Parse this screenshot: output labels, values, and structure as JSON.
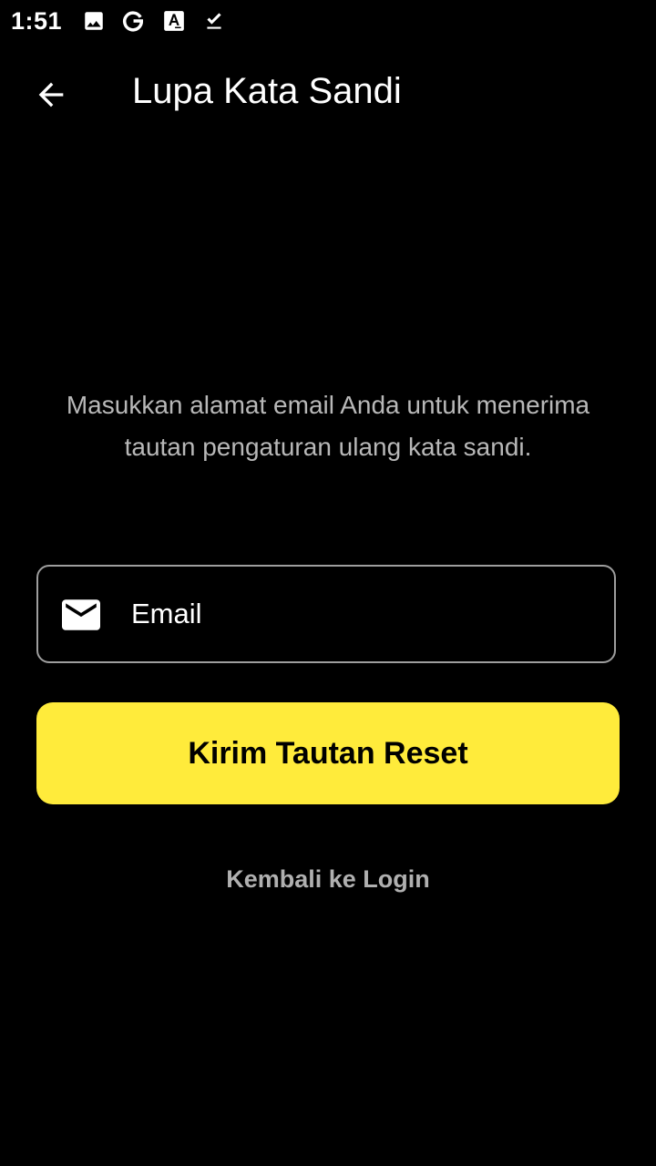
{
  "status_bar": {
    "time": "1:51",
    "icons": [
      "image-icon",
      "google-icon",
      "translate-a-icon",
      "download-done-icon"
    ]
  },
  "app_bar": {
    "title": "Lupa Kata Sandi",
    "back_icon": "arrow-left-icon"
  },
  "form": {
    "description": "Masukkan alamat email Anda untuk menerima tautan pengaturan ulang kata sandi.",
    "email_placeholder": "Email",
    "email_value": "",
    "email_icon": "mail-icon",
    "submit_label": "Kirim Tautan Reset",
    "back_to_login_label": "Kembali ke Login"
  },
  "colors": {
    "background": "#000000",
    "accent": "#ffeb3b",
    "description_text": "#b8b8b8",
    "field_border": "#9e9e9e",
    "link_text": "#b0b0b0"
  }
}
